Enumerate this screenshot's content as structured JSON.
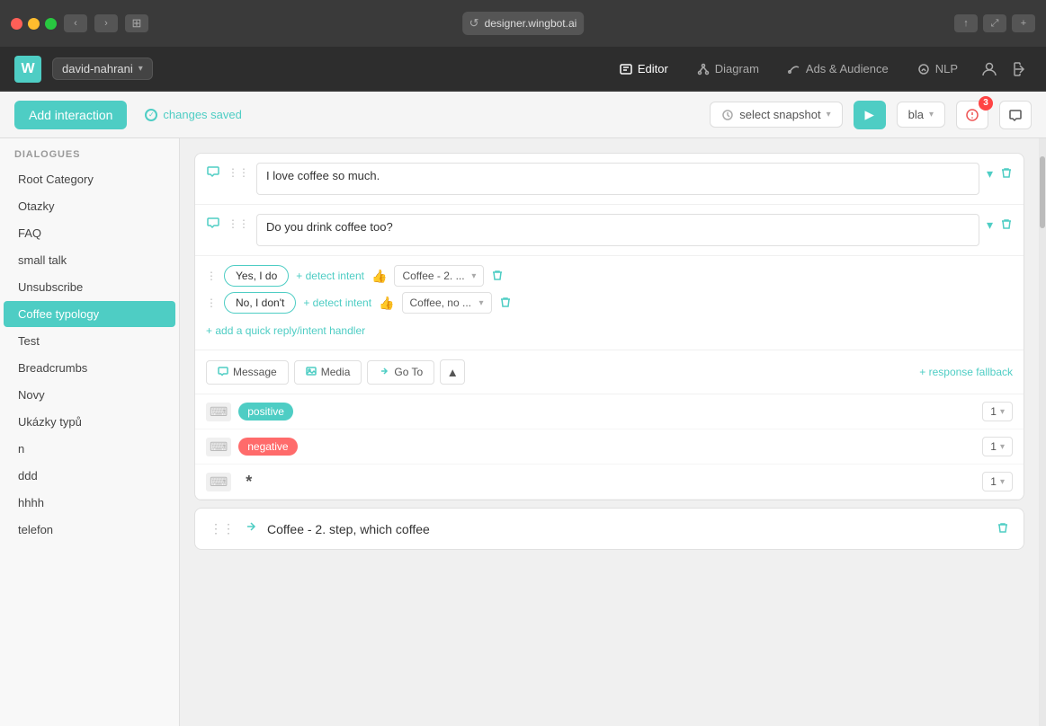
{
  "window": {
    "title": "designer.wingbot.ai",
    "chrome": {
      "back_label": "‹",
      "forward_label": "›",
      "grid_icon": "⊞",
      "reload_icon": "↺",
      "share_icon": "↑",
      "expand_icon": "⤢",
      "plus_icon": "+"
    }
  },
  "app": {
    "logo": "W",
    "workspace": "david-nahrani",
    "nav_tabs": [
      {
        "id": "editor",
        "label": "Editor",
        "icon": "editor",
        "active": true
      },
      {
        "id": "diagram",
        "label": "Diagram",
        "icon": "diagram",
        "active": false
      },
      {
        "id": "ads_audience",
        "label": "Ads & Audience",
        "icon": "ads",
        "active": false
      },
      {
        "id": "nlp",
        "label": "NLP",
        "icon": "nlp",
        "active": false
      }
    ],
    "user_icon": "👤",
    "logout_icon": "→"
  },
  "toolbar": {
    "add_interaction_label": "Add interaction",
    "changes_saved_label": "changes saved",
    "snapshot_placeholder": "select snapshot",
    "play_icon": "▶",
    "env_selector_value": "bla",
    "alert_count": "3",
    "chat_icon": "💬"
  },
  "sidebar": {
    "section_label": "DIALOGUES",
    "items": [
      {
        "id": "root-category",
        "label": "Root Category",
        "active": false
      },
      {
        "id": "otazky",
        "label": "Otazky",
        "active": false
      },
      {
        "id": "faq",
        "label": "FAQ",
        "active": false
      },
      {
        "id": "small-talk",
        "label": "small talk",
        "active": false
      },
      {
        "id": "unsubscribe",
        "label": "Unsubscribe",
        "active": false
      },
      {
        "id": "coffee-typology",
        "label": "Coffee typology",
        "active": true
      },
      {
        "id": "test",
        "label": "Test",
        "active": false
      },
      {
        "id": "breadcrumbs",
        "label": "Breadcrumbs",
        "active": false
      },
      {
        "id": "novy",
        "label": "Novy",
        "active": false
      },
      {
        "id": "ukazky-typu",
        "label": "Ukázky typů",
        "active": false
      },
      {
        "id": "n",
        "label": "n",
        "active": false
      },
      {
        "id": "ddd",
        "label": "ddd",
        "active": false
      },
      {
        "id": "hhhh",
        "label": "hhhh",
        "active": false
      },
      {
        "id": "telefon",
        "label": "telefon",
        "active": false
      }
    ]
  },
  "content": {
    "dialogue_cards": [
      {
        "id": "card-1",
        "messages": [
          {
            "id": "msg-1",
            "text": "I love coffee so much."
          },
          {
            "id": "msg-2",
            "text": "Do you drink coffee too?"
          }
        ],
        "quick_replies": [
          {
            "id": "qr-1",
            "label": "Yes, I do",
            "detect_intent_label": "detect intent",
            "intent_value": "Coffee - 2. ...",
            "chevron": "▾"
          },
          {
            "id": "qr-2",
            "label": "No, I don't",
            "detect_intent_label": "detect intent",
            "intent_value": "Coffee, no ...",
            "chevron": "▾"
          }
        ],
        "add_quick_reply_label": "add a quick reply/intent handler",
        "action_buttons": [
          {
            "id": "message-btn",
            "label": "Message",
            "icon": "💬"
          },
          {
            "id": "media-btn",
            "label": "Media",
            "icon": "🖼"
          },
          {
            "id": "goto-btn",
            "label": "Go To",
            "icon": "⤷"
          }
        ],
        "response_fallback_label": "response fallback",
        "intent_rows": [
          {
            "id": "positive",
            "label": "positive",
            "type": "positive",
            "num": "1"
          },
          {
            "id": "negative",
            "label": "negative",
            "type": "negative",
            "num": "1"
          },
          {
            "id": "asterisk",
            "label": "*",
            "type": "asterisk",
            "num": "1"
          }
        ]
      }
    ],
    "card_2": {
      "title": "Coffee - 2. step, which coffee"
    }
  }
}
